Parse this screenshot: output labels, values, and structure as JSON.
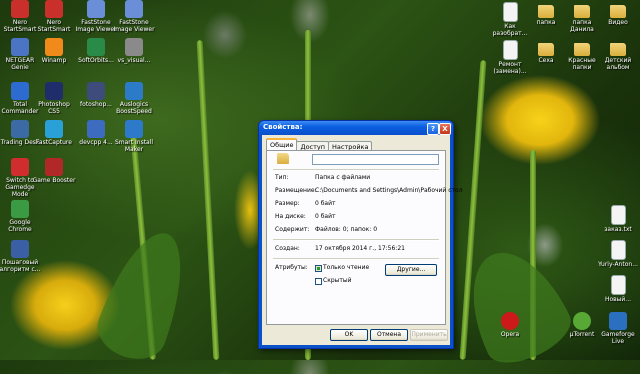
{
  "desktop": {
    "left_icons": [
      {
        "label": "Nero StartSmart",
        "color": "#c9302c"
      },
      {
        "label": "Nero StartSmart",
        "color": "#c9302c"
      },
      {
        "label": "FastStone Image Viewer",
        "color": "#6a8fd8"
      },
      {
        "label": "FastStone Image Viewer",
        "color": "#6a8fd8"
      },
      {
        "label": "NETGEAR Genie",
        "color": "#4b74c4"
      },
      {
        "label": "Winamp",
        "color": "#f08a1a"
      },
      {
        "label": "SoftOrbits...",
        "color": "#2a8a48"
      },
      {
        "label": "vs_visual...",
        "color": "#8a8a8a"
      },
      {
        "label": "Total Commander",
        "color": "#2d6bd1"
      },
      {
        "label": "Photoshop CS5",
        "color": "#1f2e6b"
      },
      {
        "label": "fotoshop...",
        "color": "#3d4c7a"
      },
      {
        "label": "Auslogics BoostSpeed",
        "color": "#2b7bc9"
      },
      {
        "label": "Trading Desk",
        "color": "#3b6aa5"
      },
      {
        "label": "FastCapture",
        "color": "#2aa0d8"
      },
      {
        "label": "devcpp 4...",
        "color": "#3c6bbf"
      },
      {
        "label": "Smart Install Maker",
        "color": "#2c7ac9"
      },
      {
        "label": "Switch to Gamedge Mode",
        "color": "#d02e2e"
      },
      {
        "label": "Game Booster",
        "color": "#b02828"
      },
      {
        "label": "Google Chrome",
        "color": "#3b9b45"
      },
      {
        "label": "Пошаговый алгоритм с...",
        "color": "#3a5fa5"
      }
    ],
    "right_icons": [
      {
        "label": "Как разобрат...",
        "type": "doc"
      },
      {
        "label": "папка",
        "type": "folder"
      },
      {
        "label": "папка Данила",
        "type": "folder"
      },
      {
        "label": "Видео",
        "type": "folder"
      },
      {
        "label": "Ремонт (замена)...",
        "type": "doc"
      },
      {
        "label": "Сеха",
        "type": "folder"
      },
      {
        "label": "Красные папки",
        "type": "folder"
      },
      {
        "label": "Детский альбом",
        "type": "folder"
      },
      {
        "label": "заказ.txt",
        "type": "doc"
      },
      {
        "label": "Yuriy-Anton...",
        "type": "doc"
      },
      {
        "label": "Новый...",
        "type": "doc"
      },
      {
        "label": "Opera",
        "type": "opera"
      },
      {
        "label": "µTorrent",
        "type": "torrent"
      },
      {
        "label": "Gameforge Live",
        "type": "game"
      }
    ]
  },
  "dialog": {
    "title": "Свойства:",
    "help_glyph": "?",
    "close_glyph": "X",
    "tabs": [
      "Общие",
      "Доступ",
      "Настройка"
    ],
    "name_value": "",
    "fields": [
      {
        "label": "Тип:",
        "value": "Папка с файлами"
      },
      {
        "label": "Размещение:",
        "value": "C:\\Documents and Settings\\Admin\\Рабочий стол"
      },
      {
        "label": "Размер:",
        "value": "0 байт"
      },
      {
        "label": "На диске:",
        "value": "0 байт"
      },
      {
        "label": "Содержит:",
        "value": "Файлов: 0; папок: 0"
      },
      {
        "label": "Создан:",
        "value": "17 октября 2014 г., 17:56:21"
      }
    ],
    "attributes_label": "Атрибуты:",
    "readonly_label": "Только чтение",
    "hidden_label": "Скрытый",
    "other_button": "Другие...",
    "ok_button": "OK",
    "cancel_button": "Отмена",
    "apply_button": "Применить"
  }
}
